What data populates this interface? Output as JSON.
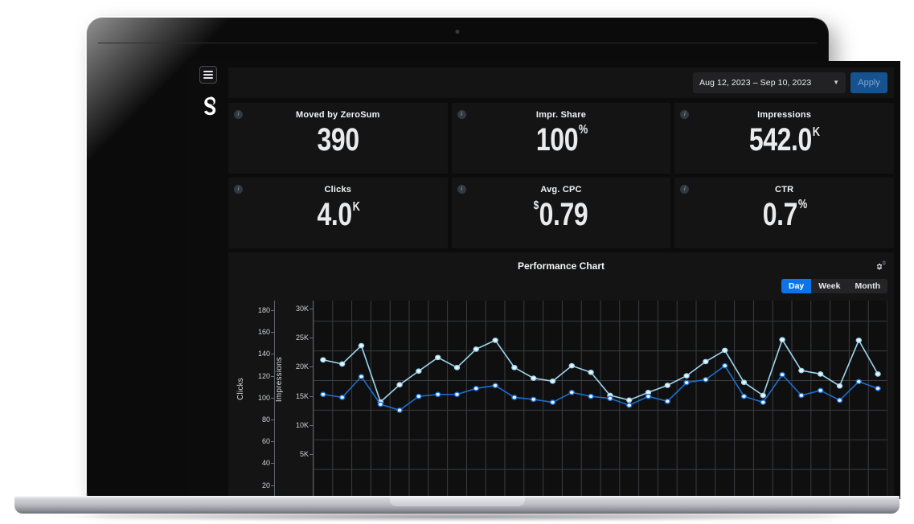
{
  "app": {
    "brand_logo_name": "zerosum-logo",
    "menu_icon": "hamburger-icon"
  },
  "topbar": {
    "date_range_value": "Aug 12, 2023 – Sep 10, 2023",
    "date_range_caret": "▼",
    "apply_label": "Apply"
  },
  "kpis": [
    {
      "title": "Moved by ZeroSum",
      "prefix": "",
      "value": "390",
      "suffix": "",
      "info_icon": "info-icon"
    },
    {
      "title": "Impr. Share",
      "prefix": "",
      "value": "100",
      "suffix": "%",
      "info_icon": "info-icon"
    },
    {
      "title": "Impressions",
      "prefix": "",
      "value": "542.0",
      "suffix": "K",
      "info_icon": "info-icon"
    },
    {
      "title": "Clicks",
      "prefix": "",
      "value": "4.0",
      "suffix": "K",
      "info_icon": "info-icon"
    },
    {
      "title": "Avg. CPC",
      "prefix": "$",
      "value": "0.79",
      "suffix": "",
      "info_icon": "info-icon"
    },
    {
      "title": "CTR",
      "prefix": "",
      "value": "0.7",
      "suffix": "%",
      "info_icon": "info-icon"
    }
  ],
  "chart_panel": {
    "title": "Performance Chart",
    "settings_icon": "gear-settings-icon",
    "granularity": [
      {
        "label": "Day",
        "active": true
      },
      {
        "label": "Week",
        "active": false
      },
      {
        "label": "Month",
        "active": false
      }
    ]
  },
  "chart_data": {
    "type": "line",
    "title": "Performance Chart",
    "xlabel": "",
    "grid": true,
    "legend": "none",
    "axes": [
      {
        "id": "clicks",
        "ylabel": "Clicks",
        "ylim": [
          20,
          180
        ],
        "ticks": [
          180,
          160,
          140,
          120,
          100,
          80,
          60,
          40,
          20
        ],
        "color": "#1f6fd0",
        "side": "left-inner"
      },
      {
        "id": "impressions",
        "ylabel": "Impressions",
        "ylim": [
          0,
          30000
        ],
        "ticks": [
          "30K",
          "25K",
          "20K",
          "15K",
          "10K",
          "5K"
        ],
        "tick_values": [
          30000,
          25000,
          20000,
          15000,
          10000,
          5000
        ],
        "color": "#9fd6ef",
        "side": "left-outer"
      }
    ],
    "x": [
      1,
      2,
      3,
      4,
      5,
      6,
      7,
      8,
      9,
      10,
      11,
      12,
      13,
      14,
      15,
      16,
      17,
      18,
      19,
      20,
      21,
      22,
      23,
      24,
      25,
      26,
      27,
      28,
      29,
      30
    ],
    "series": [
      {
        "name": "Impressions",
        "axis": "impressions",
        "color": "#9fd6ef",
        "values": [
          23500,
          22800,
          25900,
          16400,
          19300,
          21600,
          23900,
          22200,
          25300,
          26800,
          22200,
          20400,
          19900,
          22500,
          21400,
          17500,
          16700,
          18000,
          19200,
          20800,
          23200,
          25100,
          19700,
          17500,
          26900,
          21700,
          21100,
          19100,
          26800,
          21100
        ]
      },
      {
        "name": "Clicks",
        "axis": "clicks",
        "color": "#1f6fd0",
        "values": [
          106,
          103,
          124,
          96,
          90,
          104,
          106,
          106,
          112,
          115,
          103,
          101,
          98,
          108,
          104,
          102,
          95,
          104,
          99,
          118,
          121,
          135,
          104,
          98,
          126,
          105,
          110,
          100,
          119,
          112
        ]
      }
    ]
  }
}
